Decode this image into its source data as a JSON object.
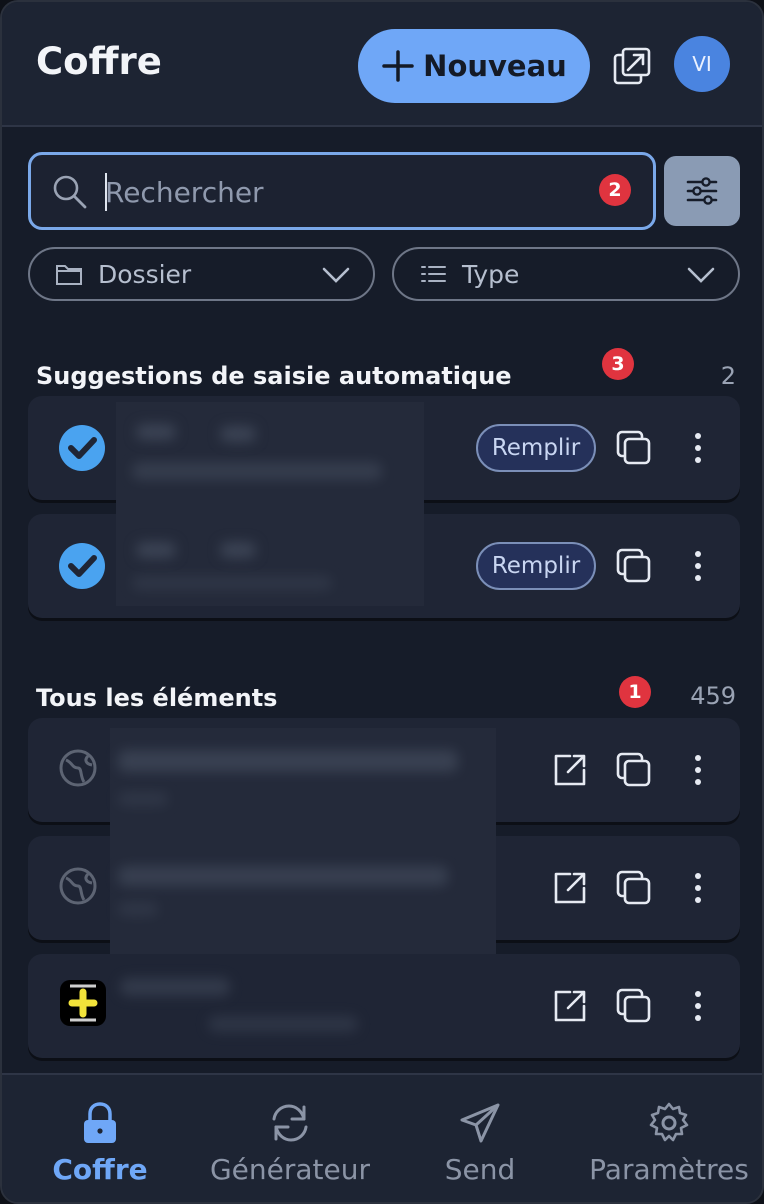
{
  "header": {
    "title": "Coffre",
    "new_label": "Nouveau",
    "avatar_initials": "VI"
  },
  "search": {
    "placeholder": "Rechercher",
    "badge": "2"
  },
  "filters": {
    "folder_label": "Dossier",
    "type_label": "Type"
  },
  "suggestions": {
    "title": "Suggestions de saisie automatique",
    "badge": "3",
    "count": "2",
    "fill_label": "Remplir"
  },
  "all_items": {
    "title": "Tous les éléments",
    "badge": "1",
    "count": "459"
  },
  "nav": {
    "vault": "Coffre",
    "generator": "Générateur",
    "send": "Send",
    "settings": "Paramètres"
  },
  "colors": {
    "accent": "#6fa7f7",
    "badge": "#e0343f",
    "background": "#161c29"
  },
  "icons": [
    "plus-icon",
    "popout-icon",
    "search-icon",
    "filter-sliders-icon",
    "folder-icon",
    "list-icon",
    "chevron-down-icon",
    "checkmark-app-icon",
    "globe-icon",
    "cross-app-icon",
    "launch-icon",
    "copy-icon",
    "more-vertical-icon",
    "lock-icon",
    "refresh-icon",
    "paper-plane-icon",
    "gear-icon"
  ]
}
